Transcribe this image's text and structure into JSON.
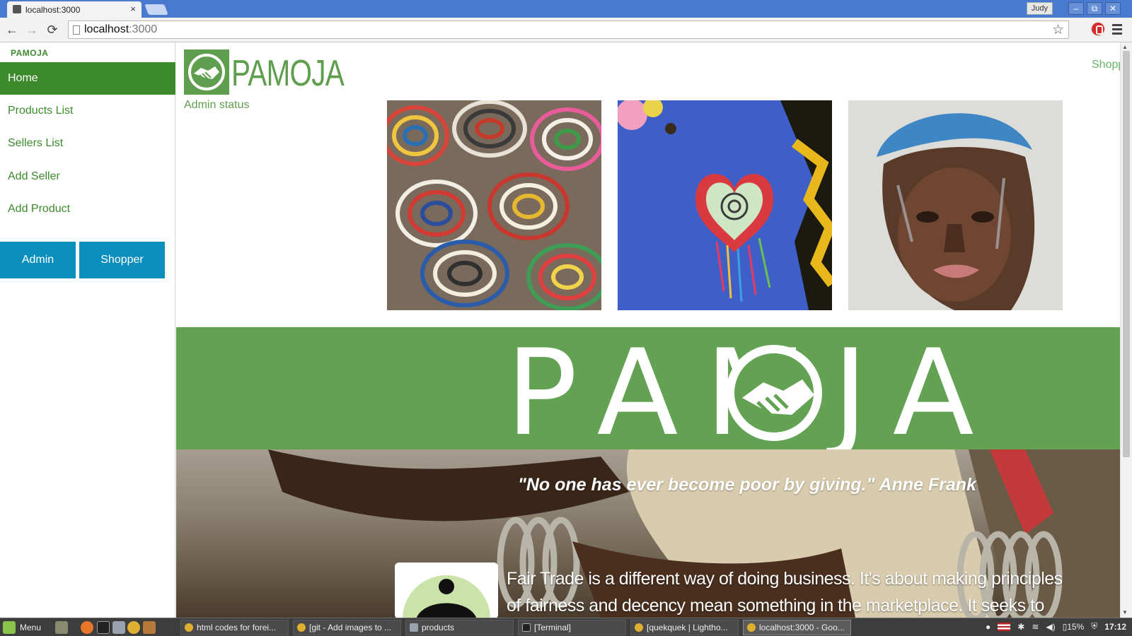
{
  "browser": {
    "tab_title": "localhost:3000",
    "tab_close": "×",
    "user": "Judy",
    "url_host": "localhost",
    "url_port": ":3000",
    "star": "☆",
    "back": "←",
    "forward": "→",
    "reload": "⟳",
    "minimize": "–",
    "restore": "⧉",
    "close": "✕"
  },
  "sidebar": {
    "brand": "PAMOJA",
    "items": [
      {
        "label": "Home",
        "active": true
      },
      {
        "label": "Products List",
        "active": false
      },
      {
        "label": "Sellers List",
        "active": false
      },
      {
        "label": "Add Seller",
        "active": false
      },
      {
        "label": "Add Product",
        "active": false
      }
    ],
    "buttons": {
      "admin": "Admin",
      "shopper": "Shopper"
    }
  },
  "header": {
    "logo_text": "PAMOJA",
    "admin_status": "Admin status",
    "shopper_link": "Shopping"
  },
  "gallery": [
    {
      "icon": "baskets-photo"
    },
    {
      "icon": "beaded-heart-photo"
    },
    {
      "icon": "portrait-painting-photo"
    }
  ],
  "banner": {
    "letters_before": "PAM",
    "letters_after": "JA"
  },
  "hero": {
    "quote": "\"No one has ever become poor by giving.\" Anne Frank",
    "body": "Fair Trade is a different way of doing business. It's about making principles of fairness and decency mean something in the marketplace. It seeks to change the terms of"
  },
  "taskbar": {
    "menu": "Menu",
    "tasks": [
      {
        "label": "html codes for forei...",
        "active": false
      },
      {
        "label": "[git - Add images to ...",
        "active": false
      },
      {
        "label": "products",
        "active": false
      },
      {
        "label": "[Terminal]",
        "active": false
      },
      {
        "label": "[quekquek | Lightho...",
        "active": false
      },
      {
        "label": "localhost:3000 - Goo...",
        "active": true
      }
    ],
    "battery": "15%",
    "clock": "17:12"
  },
  "colors": {
    "brand_green": "#3c8a2c",
    "banner_green": "#62a252",
    "button_blue": "#0a8ebc"
  }
}
